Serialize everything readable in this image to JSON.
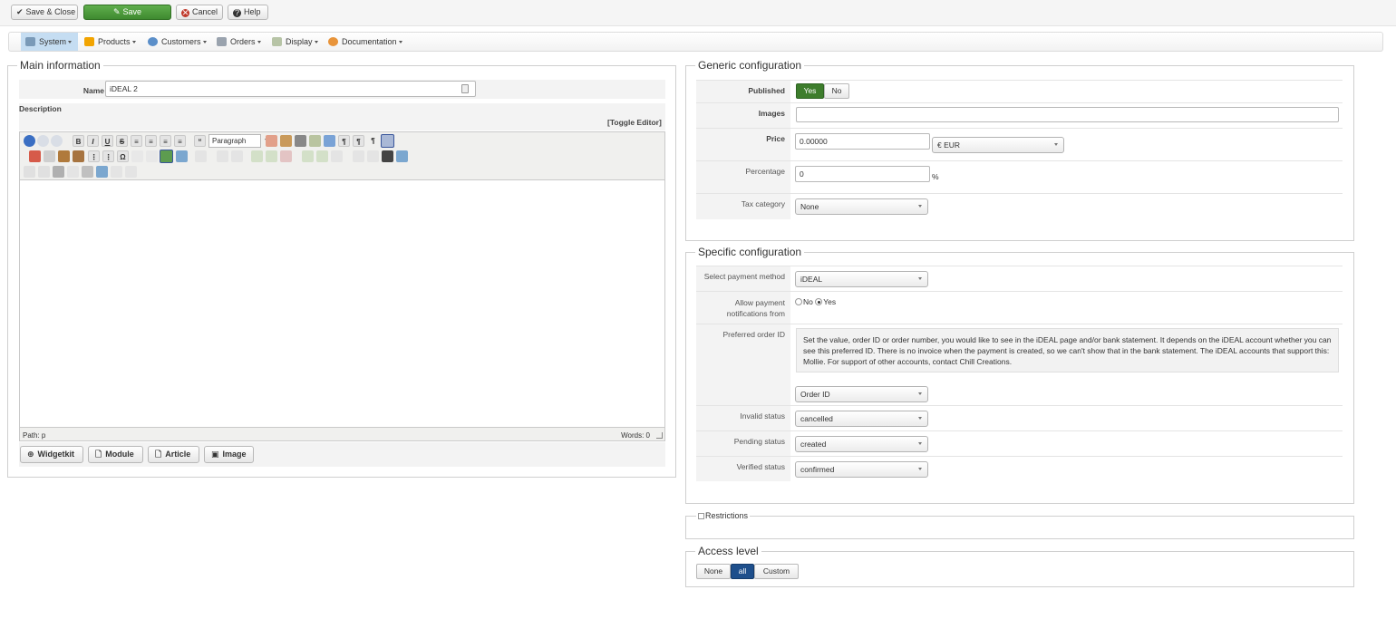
{
  "toolbar": {
    "save_close": "Save & Close",
    "save": "Save",
    "cancel": "Cancel",
    "help": "Help"
  },
  "menu": {
    "system": "System",
    "products": "Products",
    "customers": "Customers",
    "orders": "Orders",
    "display": "Display",
    "documentation": "Documentation"
  },
  "main": {
    "legend": "Main information",
    "name_label": "Name",
    "name_value": "iDEAL 2",
    "description_label": "Description",
    "toggle_editor": "[Toggle Editor]",
    "format_select": "Paragraph",
    "path": "Path: p",
    "words": "Words: 0",
    "buttons": {
      "widgetkit": "Widgetkit",
      "module": "Module",
      "article": "Article",
      "image": "Image"
    }
  },
  "generic": {
    "legend": "Generic configuration",
    "published_label": "Published",
    "published_yes": "Yes",
    "published_no": "No",
    "images_label": "Images",
    "price_label": "Price",
    "price_value": "0.00000",
    "currency": "€ EUR",
    "percentage_label": "Percentage",
    "percentage_value": "0",
    "percent_sign": "%",
    "tax_label": "Tax category",
    "tax_value": "None"
  },
  "specific": {
    "legend": "Specific configuration",
    "payment_method_label": "Select payment method",
    "payment_method_value": "iDEAL",
    "allow_label_line1": "Allow payment",
    "allow_label_line2": "notifications from",
    "allow_no": "No",
    "allow_yes": "Yes",
    "preferred_label": "Preferred order ID",
    "preferred_help": "Set the value, order ID or order number, you would like to see in the iDEAL page and/or bank statement. It depends on the iDEAL account whether you can see this preferred ID. There is no invoice when the payment is created, so we can't show that in the bank statement. The iDEAL accounts that support this: Mollie. For support of other accounts, contact Chill Creations.",
    "preferred_value": "Order ID",
    "invalid_label": "Invalid status",
    "invalid_value": "cancelled",
    "pending_label": "Pending status",
    "pending_value": "created",
    "verified_label": "Verified status",
    "verified_value": "confirmed"
  },
  "restrictions": {
    "legend": "Restrictions"
  },
  "access": {
    "legend": "Access level",
    "none": "None",
    "all": "all",
    "custom": "Custom"
  },
  "colors": {
    "green": "#3d7d2c",
    "blue": "#1e4f8c",
    "menu_active": "#c5ddf2"
  }
}
